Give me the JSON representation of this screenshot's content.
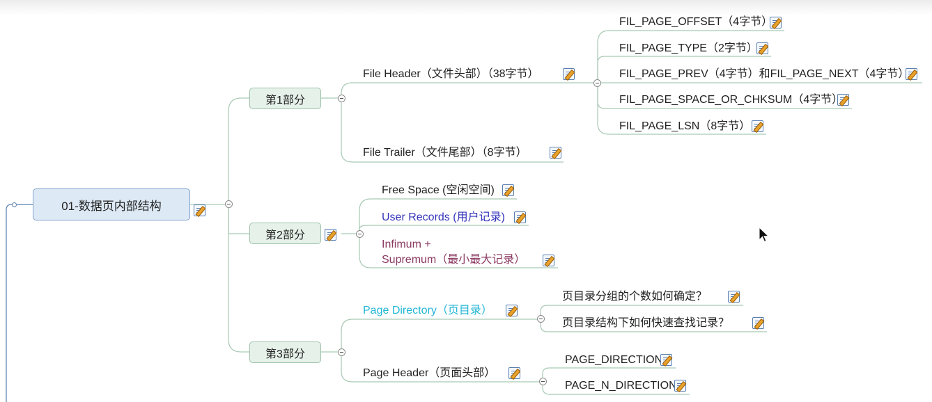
{
  "mindmap": {
    "root": "01-数据页内部结构",
    "parts": [
      "第1部分",
      "第2部分",
      "第3部分"
    ],
    "part1": {
      "file_header": "File Header（文件头部）（38字节）",
      "file_trailer": "File Trailer（文件尾部）（8字节）",
      "fh_children": [
        "FIL_PAGE_OFFSET（4字节）",
        "FIL_PAGE_TYPE（2字节）",
        "FIL_PAGE_PREV（4字节）和FIL_PAGE_NEXT（4字节）",
        "FIL_PAGE_SPACE_OR_CHKSUM（4字节）",
        "FIL_PAGE_LSN（8字节）"
      ]
    },
    "part2": {
      "free_space": "Free Space (空闲空间)",
      "user_records": "User Records (用户记录)",
      "infimum_line1": "Infimum +",
      "infimum_line2": "Supremum（最小最大记录）"
    },
    "part3": {
      "page_directory": "Page Directory（页目录）",
      "page_header": "Page Header（页面头部）",
      "pd_children": [
        "页目录分组的个数如何确定？",
        "页目录结构下如何快速查找记录？"
      ],
      "ph_children": [
        "PAGE_DIRECTION",
        "PAGE_N_DIRECTION"
      ]
    }
  },
  "colors": {
    "line": "#9fc6ae",
    "root_line": "#5a7fb0",
    "user_records": "#3333bb",
    "infimum": "#8b3a62",
    "page_directory": "#21b6d6"
  }
}
